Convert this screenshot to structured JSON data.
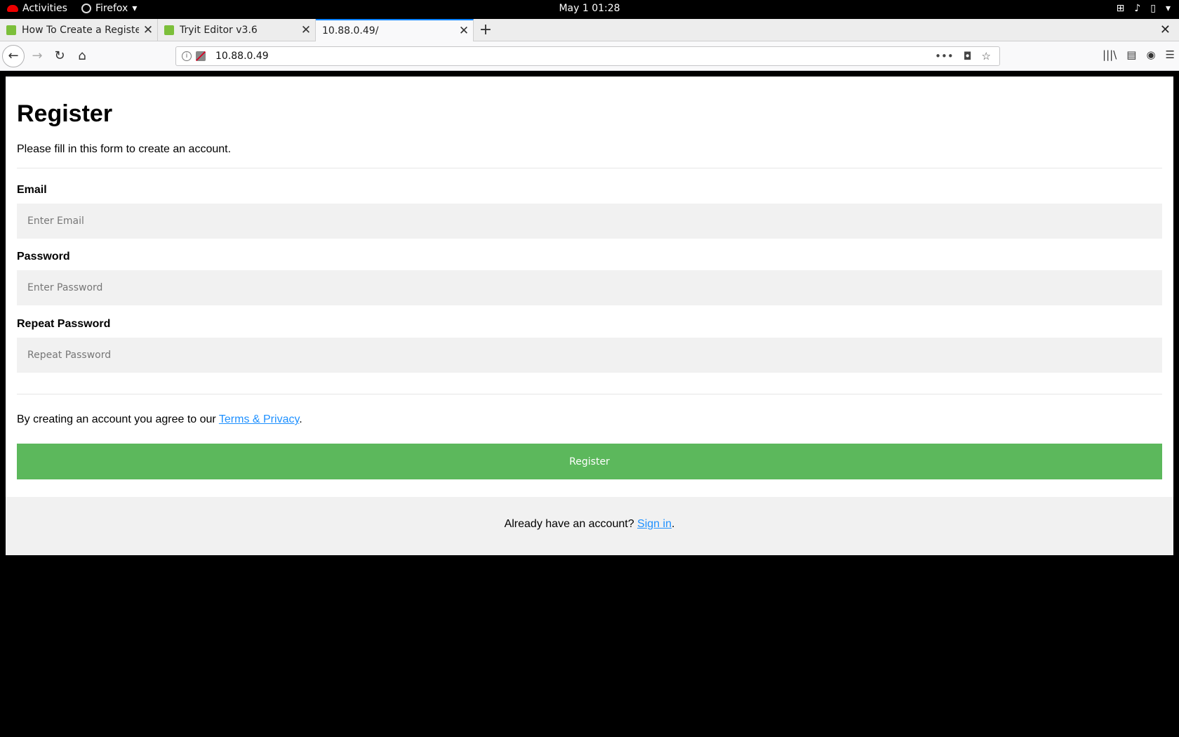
{
  "system_bar": {
    "activities": "Activities",
    "app_name": "Firefox",
    "app_menu_arrow": "▾",
    "clock": "May 1  01:28",
    "tray_icons": [
      "network-icon",
      "volume-icon",
      "battery-icon",
      "menu-arrow-icon"
    ]
  },
  "browser": {
    "tabs": [
      {
        "title": "How To Create a Register",
        "favicon": "w3-icon",
        "active": false
      },
      {
        "title": "Tryit Editor v3.6",
        "favicon": "w3-icon",
        "active": false
      },
      {
        "title": "10.88.0.49/",
        "favicon": "",
        "active": true
      }
    ],
    "tab_close_glyph": "✕",
    "new_tab_glyph": "+",
    "window_close_glyph": "✕",
    "url": "10.88.0.49",
    "nav_glyphs": {
      "back": "←",
      "forward": "→",
      "reload": "↻",
      "home": "⌂"
    },
    "url_action_glyphs": {
      "more": "•••",
      "pocket": "◘",
      "bookmark": "☆"
    },
    "toolbar_glyphs": {
      "library": "|||\\",
      "sidebar": "▤",
      "account": "◉",
      "menu": "☰"
    }
  },
  "page": {
    "title": "Register",
    "lead": "Please fill in this form to create an account.",
    "fields": [
      {
        "label": "Email",
        "placeholder": "Enter Email",
        "value": ""
      },
      {
        "label": "Password",
        "placeholder": "Enter Password",
        "value": ""
      },
      {
        "label": "Repeat Password",
        "placeholder": "Repeat Password",
        "value": ""
      }
    ],
    "terms_prefix": "By creating an account you agree to our ",
    "terms_link": "Terms & Privacy",
    "terms_suffix": ".",
    "register_button": "Register",
    "signin_prefix": "Already have an account? ",
    "signin_link": "Sign in",
    "signin_suffix": ".",
    "colors": {
      "button": "#5cb85c",
      "link": "#1e90ff",
      "input_bg": "#f1f1f1",
      "tab_accent": "#0a84ff"
    }
  }
}
